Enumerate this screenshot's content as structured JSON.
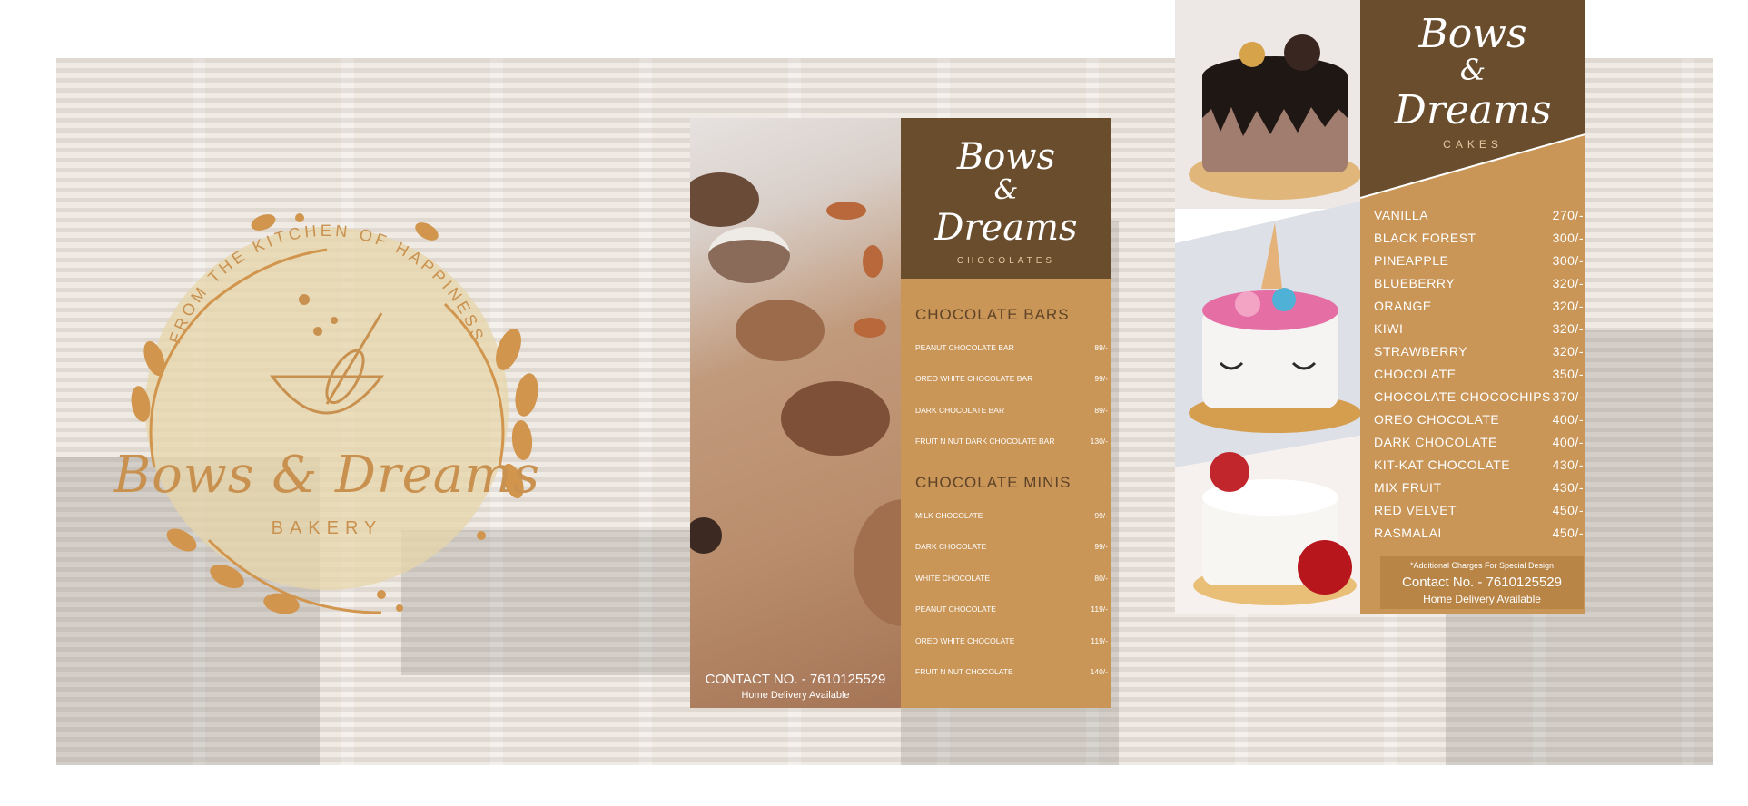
{
  "logo": {
    "arc_text": "FROM THE KITCHEN OF HAPPINESS",
    "title": "Bows & Dreams",
    "subtitle": "BAKERY",
    "color": "#c9914f"
  },
  "chocolates": {
    "brand": [
      "Bows",
      "&",
      "Dreams"
    ],
    "subtitle": "CHOCOLATES",
    "sections": [
      {
        "title": "CHOCOLATE BARS",
        "items": [
          {
            "name": "PEANUT CHOCOLATE BAR",
            "price": "89/-"
          },
          {
            "name": "OREO WHITE CHOCOLATE BAR",
            "price": "99/-"
          },
          {
            "name": "DARK CHOCOLATE BAR",
            "price": "89/-"
          },
          {
            "name": "FRUIT N NUT DARK CHOCOLATE BAR",
            "price": "130/-"
          }
        ]
      },
      {
        "title": "CHOCOLATE MINIS",
        "items": [
          {
            "name": "MILK CHOCOLATE",
            "price": "99/-"
          },
          {
            "name": "DARK CHOCOLATE",
            "price": "99/-"
          },
          {
            "name": "WHITE CHOCOLATE",
            "price": "80/-"
          },
          {
            "name": "PEANUT CHOCOLATE",
            "price": "119/-"
          },
          {
            "name": "OREO WHITE CHOCOLATE",
            "price": "119/-"
          },
          {
            "name": "FRUIT N NUT CHOCOLATE",
            "price": "140/-"
          }
        ]
      }
    ],
    "contact": "CONTACT NO. - 7610125529",
    "delivery": "Home Delivery Available",
    "colors": {
      "brown": "#694d2d",
      "tan": "#c99658"
    }
  },
  "cakes": {
    "brand": [
      "Bows",
      "&",
      "Dreams"
    ],
    "subtitle": "CAKES",
    "items": [
      {
        "name": "VANILLA",
        "price": "270/-"
      },
      {
        "name": "BLACK FOREST",
        "price": "300/-"
      },
      {
        "name": "PINEAPPLE",
        "price": "300/-"
      },
      {
        "name": "BLUEBERRY",
        "price": "320/-"
      },
      {
        "name": "ORANGE",
        "price": "320/-"
      },
      {
        "name": "KIWI",
        "price": "320/-"
      },
      {
        "name": "STRAWBERRY",
        "price": "320/-"
      },
      {
        "name": "CHOCOLATE",
        "price": "350/-"
      },
      {
        "name": "CHOCOLATE CHOCOCHIPS",
        "price": "370/-"
      },
      {
        "name": "OREO CHOCOLATE",
        "price": "400/-"
      },
      {
        "name": "DARK CHOCOLATE",
        "price": "400/-"
      },
      {
        "name": "KIT-KAT CHOCOLATE",
        "price": "430/-"
      },
      {
        "name": "MIX FRUIT",
        "price": "430/-"
      },
      {
        "name": "RED VELVET",
        "price": "450/-"
      },
      {
        "name": "RASMALAI",
        "price": "450/-"
      }
    ],
    "note": "*Additional Charges For Special Design",
    "contact": "Contact No. - 7610125529",
    "delivery": "Home Delivery Available"
  }
}
